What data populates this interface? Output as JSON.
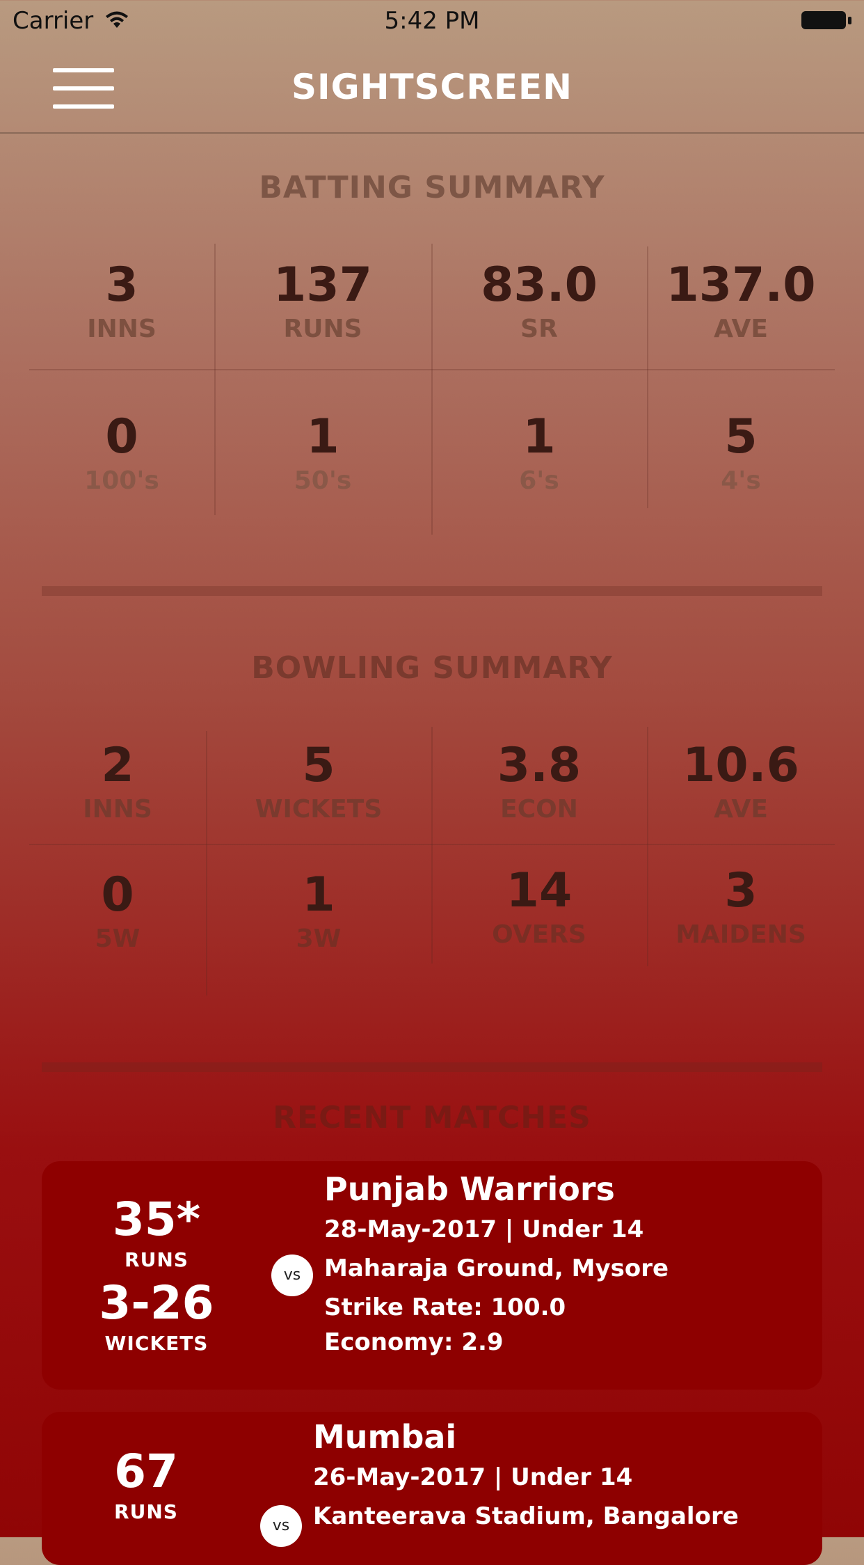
{
  "status_bar": {
    "carrier": "Carrier",
    "time": "5:42 PM"
  },
  "nav": {
    "title": "SIGHTSCREEN"
  },
  "batting": {
    "title": "BATTING SUMMARY",
    "stats": [
      {
        "value": "3",
        "label": "INNS"
      },
      {
        "value": "137",
        "label": "RUNS"
      },
      {
        "value": "83.0",
        "label": "SR"
      },
      {
        "value": "137.0",
        "label": "AVE"
      },
      {
        "value": "0",
        "label": "100's"
      },
      {
        "value": "1",
        "label": "50's"
      },
      {
        "value": "1",
        "label": "6's"
      },
      {
        "value": "5",
        "label": "4's"
      }
    ]
  },
  "bowling": {
    "title": "BOWLING SUMMARY",
    "stats": [
      {
        "value": "2",
        "label": "INNS"
      },
      {
        "value": "5",
        "label": "WICKETS"
      },
      {
        "value": "3.8",
        "label": "ECON"
      },
      {
        "value": "10.6",
        "label": "AVE"
      },
      {
        "value": "0",
        "label": "5W"
      },
      {
        "value": "1",
        "label": "3W"
      },
      {
        "value": "14",
        "label": "OVERS"
      },
      {
        "value": "3",
        "label": "MAIDENS"
      }
    ]
  },
  "recent": {
    "title": "RECENT MATCHES",
    "vs_label": "vs",
    "matches": [
      {
        "runs": "35*",
        "runs_label": "RUNS",
        "wickets": "3-26",
        "wickets_label": "WICKETS",
        "opponent": "Punjab Warriors",
        "date_category": "28-May-2017 | Under 14",
        "venue": "Maharaja Ground, Mysore",
        "strike_rate": "Strike Rate: 100.0",
        "economy": "Economy: 2.9"
      },
      {
        "runs": "67",
        "runs_label": "RUNS",
        "opponent": "Mumbai",
        "date_category": "26-May-2017 | Under 14",
        "venue": "Kanteerava Stadium, Bangalore"
      }
    ]
  },
  "colors": {
    "card_bg": "#8e0000",
    "nav_text": "#ffffff"
  }
}
